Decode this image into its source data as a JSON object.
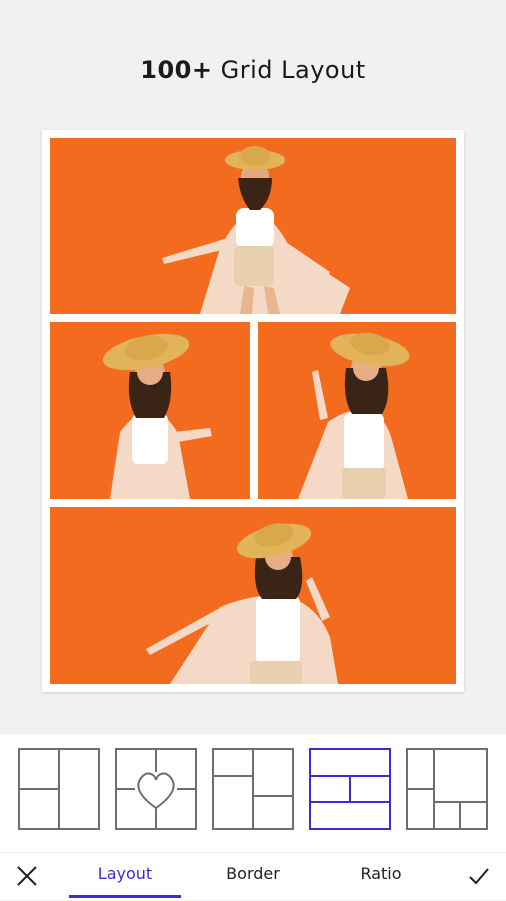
{
  "header": {
    "title_bold": "100+",
    "title_rest": " Grid Layout"
  },
  "collage": {
    "background_color": "#f26b1f",
    "photos": [
      {
        "label": "photo-top"
      },
      {
        "label": "photo-middle-left"
      },
      {
        "label": "photo-middle-right"
      },
      {
        "label": "photo-bottom"
      }
    ]
  },
  "layout_options": {
    "items": [
      {
        "name": "layout-two-rows-split"
      },
      {
        "name": "layout-heart"
      },
      {
        "name": "layout-mixed-grid"
      },
      {
        "name": "layout-three-rows",
        "selected": true
      },
      {
        "name": "layout-five-cells"
      }
    ],
    "selected_color": "#3a2dd6"
  },
  "tabs": {
    "items": [
      {
        "label": "Layout",
        "active": true
      },
      {
        "label": "Border",
        "active": false
      },
      {
        "label": "Ratio",
        "active": false
      }
    ]
  },
  "actions": {
    "close_icon": "close-icon",
    "confirm_icon": "check-icon"
  }
}
